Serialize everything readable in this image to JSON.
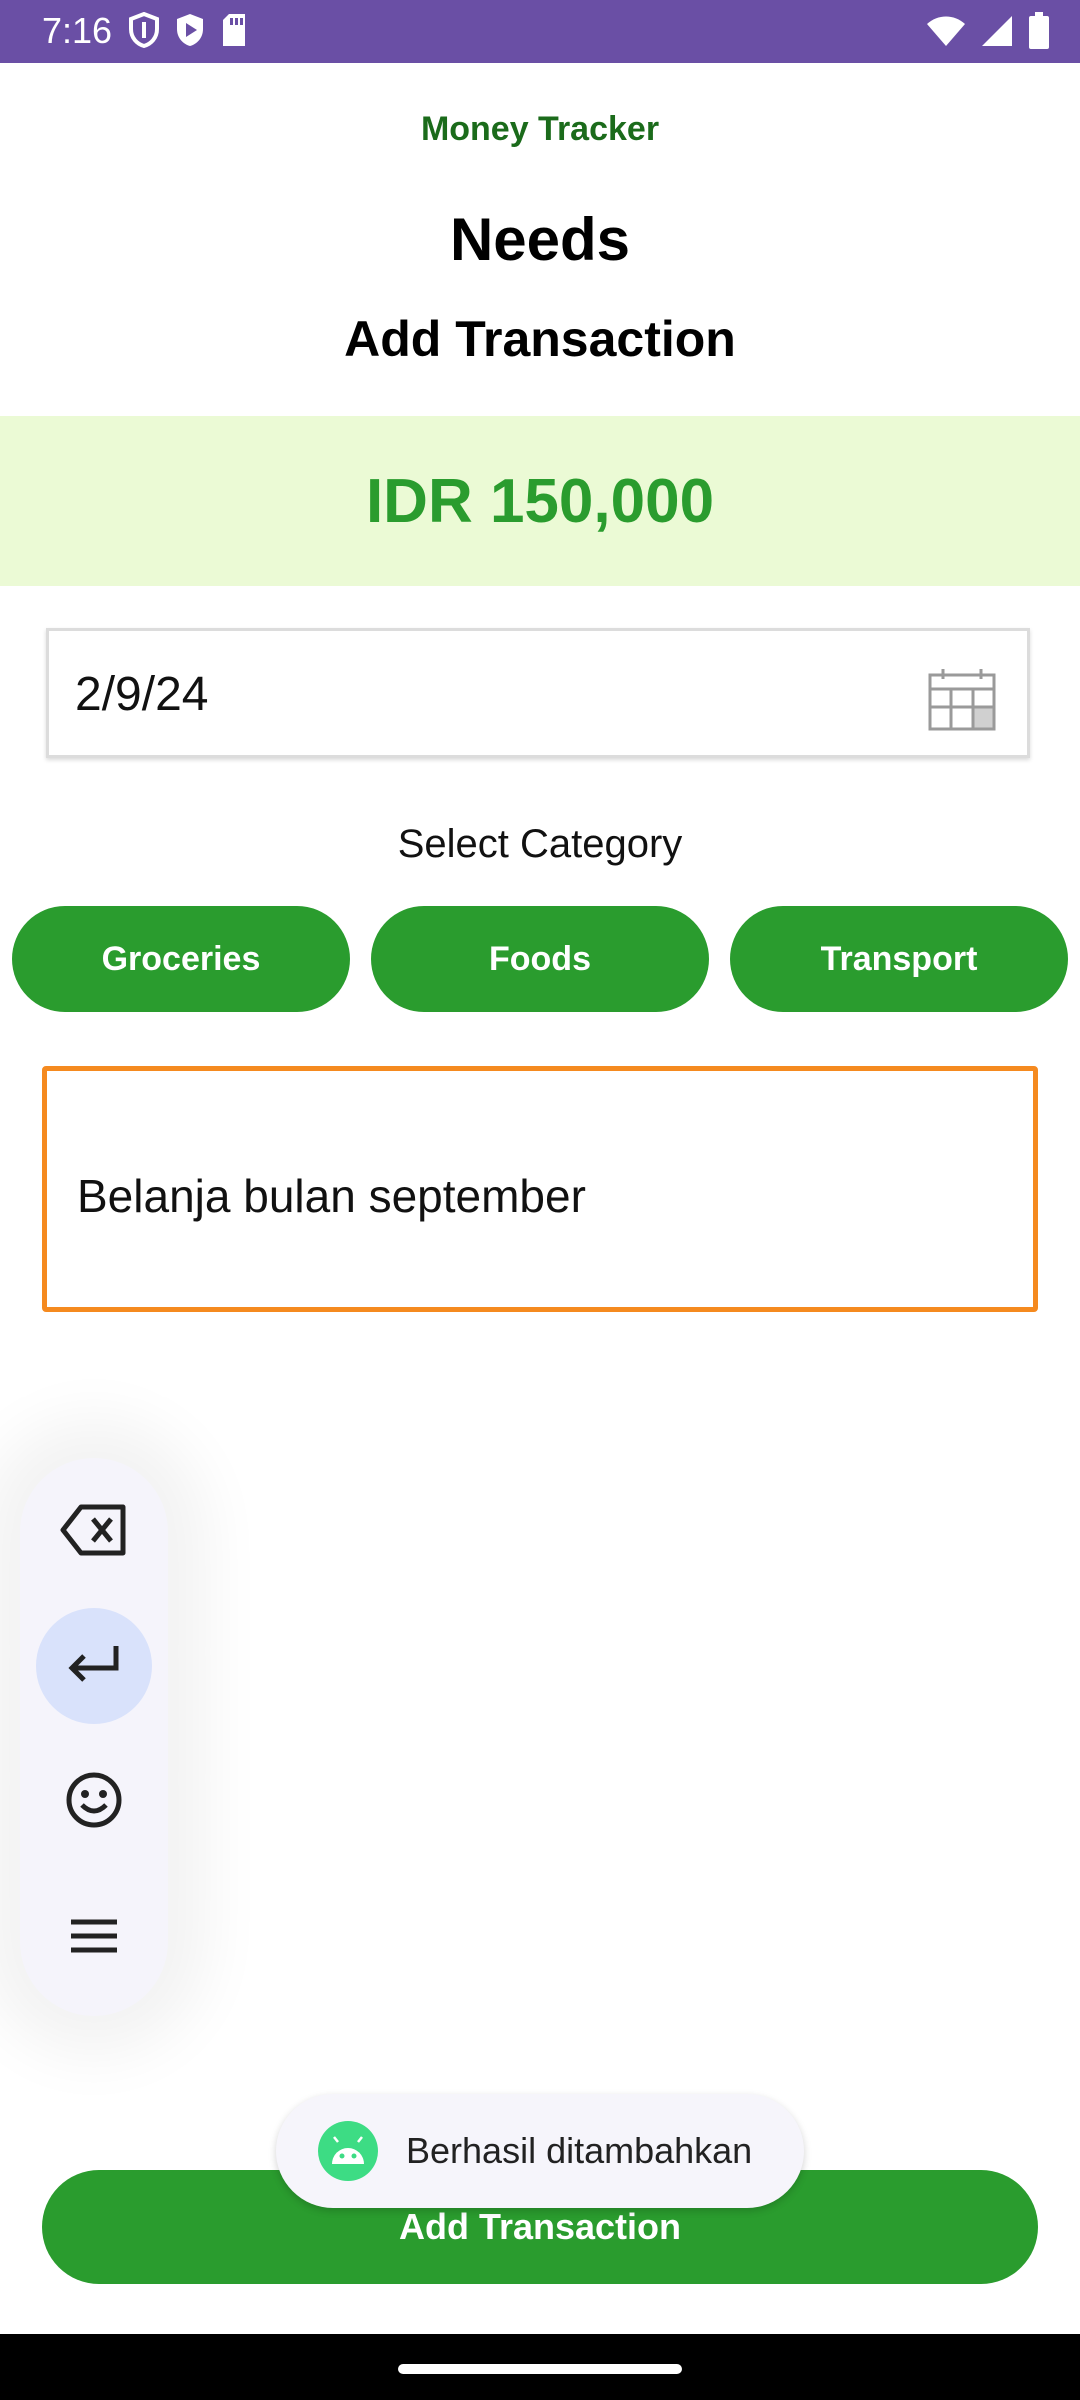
{
  "status_bar": {
    "time": "7:16",
    "left_icons": [
      "shield-icon",
      "play-icon",
      "sd-card-icon"
    ],
    "right_icons": [
      "wifi-icon",
      "signal-icon",
      "battery-icon"
    ],
    "color": "#6a4fa5"
  },
  "header": {
    "app_title": "Money Tracker",
    "page_title": "Needs",
    "subtitle": "Add Transaction"
  },
  "amount": {
    "text": "IDR 150,000",
    "color": "#2a9c2e",
    "background": "#ebfad5"
  },
  "date_field": {
    "value": "2/9/24",
    "icon": "calendar-icon"
  },
  "category": {
    "label": "Select Category",
    "options": [
      "Groceries",
      "Foods",
      "Transport"
    ],
    "color": "#2a9c2e"
  },
  "description": {
    "value": "Belanja bulan september",
    "border_color": "#f58a1f"
  },
  "keyboard_toolbar": {
    "icons": [
      "backspace-icon",
      "enter-icon",
      "emoji-icon",
      "menu-icon"
    ]
  },
  "toast": {
    "text": "Berhasil ditambahkan",
    "icon": "android-icon"
  },
  "submit": {
    "label": "Add Transaction"
  }
}
